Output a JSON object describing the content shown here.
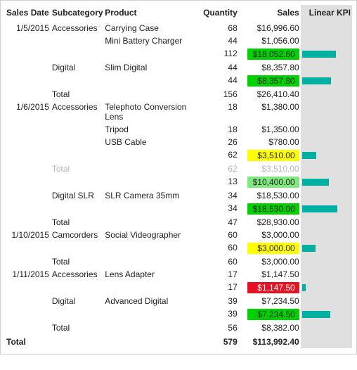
{
  "headers": {
    "date": "Sales Date",
    "subcat": "Subcategory",
    "product": "Product",
    "qty": "Quantity",
    "sales": "Sales",
    "kpi": "Linear KPI"
  },
  "rows": [
    {
      "date": "1/5/2015",
      "subcat": "Accessories",
      "product": "Carrying Case",
      "qty": "68",
      "sales": "$16,996.60"
    },
    {
      "product": "Mini Battery Charger",
      "qty": "44",
      "sales": "$1,056.00"
    },
    {
      "subtotal": true,
      "qty": "112",
      "sales": "$18,052.60",
      "color": "green",
      "kpi": 70
    },
    {
      "subcat": "Digital",
      "product": "Slim Digital",
      "qty": "44",
      "sales": "$8,357.80"
    },
    {
      "subtotal": true,
      "qty": "44",
      "sales": "$8,357.80",
      "color": "green",
      "kpi": 60
    },
    {
      "subcat": "Total",
      "qty": "156",
      "sales": "$26,410.40"
    },
    {
      "date": "1/6/2015",
      "subcat": "Accessories",
      "product": "Telephoto Conversion Lens",
      "qty": "18",
      "sales": "$1,380.00",
      "wrap": true
    },
    {
      "product": "Tripod",
      "qty": "18",
      "sales": "$1,350.00"
    },
    {
      "product": "USB Cable",
      "qty": "26",
      "sales": "$780.00"
    },
    {
      "subtotal": true,
      "qty": "62",
      "sales": "$3,510.00",
      "color": "yellow",
      "kpi": 30
    },
    {
      "subcat": "Total",
      "qty": "62",
      "sales": "$3,510.00",
      "faded": true
    },
    {
      "subtotal": true,
      "qty": "13",
      "sales": "$10,400.00",
      "color": "greenL",
      "kpi": 55
    },
    {
      "subcat": "Digital SLR",
      "product": "SLR Camera 35mm",
      "qty": "34",
      "sales": "$18,530.00"
    },
    {
      "subtotal": true,
      "qty": "34",
      "sales": "$18,530.00",
      "color": "green",
      "kpi": 72
    },
    {
      "subcat": "Total",
      "qty": "47",
      "sales": "$28,930.00"
    },
    {
      "date": "1/10/2015",
      "subcat": "Camcorders",
      "product": "Social Videographer",
      "qty": "60",
      "sales": "$3,000.00"
    },
    {
      "subtotal": true,
      "qty": "60",
      "sales": "$3,000.00",
      "color": "yellow",
      "kpi": 28
    },
    {
      "subcat": "Total",
      "qty": "60",
      "sales": "$3,000.00"
    },
    {
      "date": "1/11/2015",
      "subcat": "Accessories",
      "product": "Lens Adapter",
      "qty": "17",
      "sales": "$1,147.50"
    },
    {
      "subtotal": true,
      "qty": "17",
      "sales": "$1,147.50",
      "color": "red",
      "kpi": 8
    },
    {
      "subcat": "Digital",
      "product": "Advanced Digital",
      "qty": "39",
      "sales": "$7,234.50"
    },
    {
      "subtotal": true,
      "qty": "39",
      "sales": "$7,234.50",
      "color": "green",
      "kpi": 58
    },
    {
      "subcat": "Total",
      "qty": "56",
      "sales": "$8,382.00"
    }
  ],
  "grand": {
    "label": "Total",
    "qty": "579",
    "sales": "$113,992.40"
  }
}
